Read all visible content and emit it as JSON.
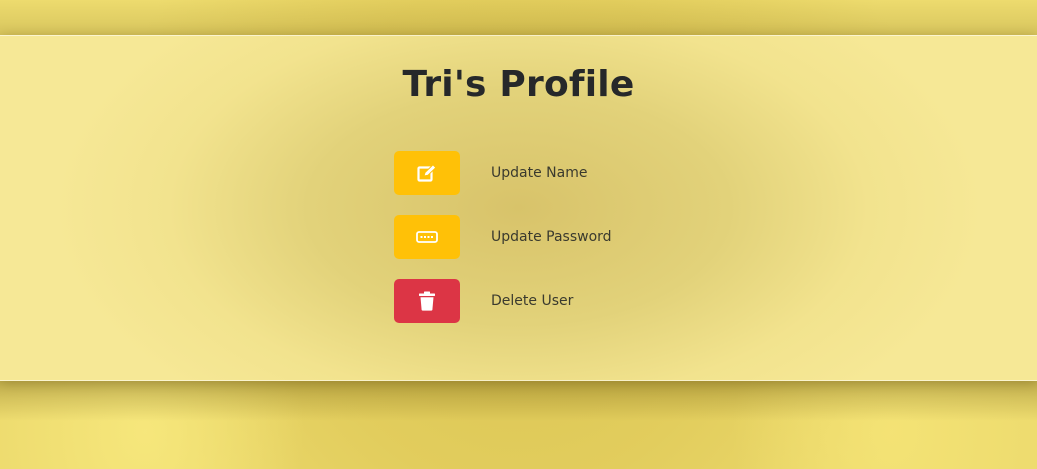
{
  "profile": {
    "title": "Tri's Profile"
  },
  "actions": [
    {
      "label": "Update Name",
      "icon": "edit-icon",
      "color": "#ffc107"
    },
    {
      "label": "Update Password",
      "icon": "password-icon",
      "color": "#ffc107"
    },
    {
      "label": "Delete User",
      "icon": "trash-icon",
      "color": "#dc3545"
    }
  ]
}
